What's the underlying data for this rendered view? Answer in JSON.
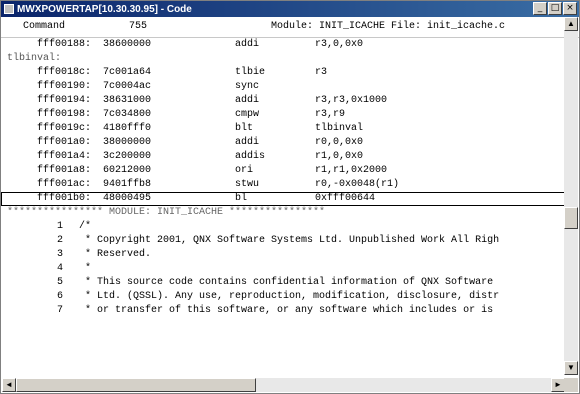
{
  "window": {
    "title": "MWXPOWERTAP[10.30.30.95] - Code",
    "minimize": "_",
    "maximize": "□",
    "close": "×"
  },
  "header": {
    "command_label": "Command",
    "line_number": "755",
    "module_info": "Module: INIT_ICACHE File: init_icache.c"
  },
  "disasm": [
    {
      "addr": "fff00188:",
      "hex": "38600000",
      "mnem": "addi",
      "ops": "r3,0,0x0"
    },
    {
      "label": "tlbinval:"
    },
    {
      "addr": "fff0018c:",
      "hex": "7c001a64",
      "mnem": "tlbie",
      "ops": "r3"
    },
    {
      "addr": "fff00190:",
      "hex": "7c0004ac",
      "mnem": "sync",
      "ops": ""
    },
    {
      "addr": "fff00194:",
      "hex": "38631000",
      "mnem": "addi",
      "ops": "r3,r3,0x1000"
    },
    {
      "addr": "fff00198:",
      "hex": "7c034800",
      "mnem": "cmpw",
      "ops": "r3,r9"
    },
    {
      "addr": "fff0019c:",
      "hex": "4180fff0",
      "mnem": "blt",
      "ops": "tlbinval"
    },
    {
      "addr": "fff001a0:",
      "hex": "38000000",
      "mnem": "addi",
      "ops": "r0,0,0x0"
    },
    {
      "addr": "fff001a4:",
      "hex": "3c200000",
      "mnem": "addis",
      "ops": "r1,0,0x0"
    },
    {
      "addr": "fff001a8:",
      "hex": "60212000",
      "mnem": "ori",
      "ops": "r1,r1,0x2000"
    },
    {
      "addr": "fff001ac:",
      "hex": "9401ffb8",
      "mnem": "stwu",
      "ops": "r0,-0x0048(r1)"
    },
    {
      "addr": "fff001b0:",
      "hex": "48000495",
      "mnem": "bl",
      "ops": "0xfff00644",
      "selected": true
    }
  ],
  "module_separator": "**************** MODULE: INIT_ICACHE ****************",
  "source": [
    {
      "num": "1",
      "text": "/*"
    },
    {
      "num": "2",
      "text": " * Copyright 2001, QNX Software Systems Ltd. Unpublished Work All Righ"
    },
    {
      "num": "3",
      "text": " * Reserved."
    },
    {
      "num": "4",
      "text": " *"
    },
    {
      "num": "5",
      "text": " * This source code contains confidential information of QNX Software"
    },
    {
      "num": "6",
      "text": " * Ltd. (QSSL). Any use, reproduction, modification, disclosure, distr"
    },
    {
      "num": "7",
      "text": " * or transfer of this software, or any software which includes or is"
    }
  ],
  "scroll": {
    "up": "▲",
    "down": "▼",
    "left": "◄",
    "right": "►"
  }
}
